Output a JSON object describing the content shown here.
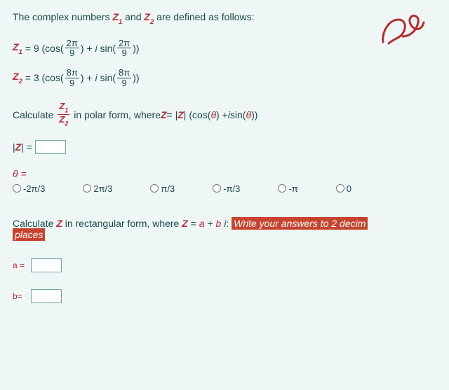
{
  "intro": {
    "prefix": "The complex numbers ",
    "z1": "Z",
    "z1_sub": "1",
    "mid": " and ",
    "z2": "Z",
    "z2_sub": "2",
    "suffix": " are defined as follows:"
  },
  "eq1": {
    "lhs_var": "Z",
    "lhs_sub": "1",
    "coef": "9",
    "num1": "2π",
    "den1": "9",
    "num2": "2π",
    "den2": "9"
  },
  "eq2": {
    "lhs_var": "Z",
    "lhs_sub": "2",
    "coef": "3",
    "num1": "8π",
    "den1": "9",
    "num2": "8π",
    "den2": "9"
  },
  "calc": {
    "word": "Calculate ",
    "frac_num": "Z",
    "frac_num_sub": "1",
    "frac_den": "Z",
    "frac_den_sub": "2",
    "mid": " in polar form, where ",
    "expr_pre": "Z = |Z| (cos(",
    "theta1": "θ",
    "expr_mid": ") + ",
    "i": "i",
    "sin": " sin(",
    "theta2": "θ",
    "expr_end": "))"
  },
  "modZ": {
    "label": "|Z| = "
  },
  "theta": {
    "label": "θ =",
    "options": [
      "-2π/3",
      "2π/3",
      "π/3",
      "-π/3",
      "-π",
      "0"
    ]
  },
  "rect": {
    "line_pre": "Calculate ",
    "Z": "Z",
    "mid1": " in rectangular form, where ",
    "eq": "Z = ",
    "a": "a",
    "plus": " + ",
    "b": "b",
    "i": " i",
    "colon": ": ",
    "hint1": "Write your answers to 2 decim",
    "hint2": "places",
    "a_label": "a =",
    "b_label": "b="
  }
}
